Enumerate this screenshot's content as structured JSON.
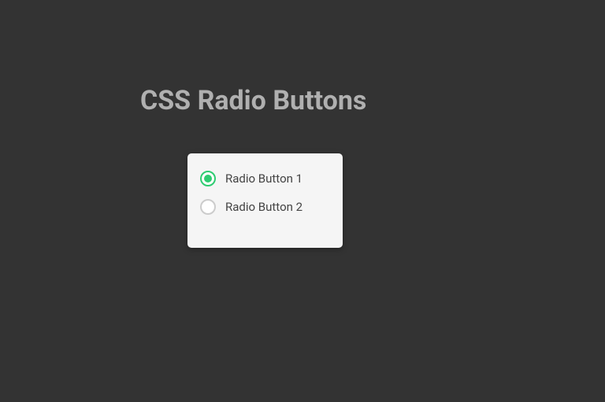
{
  "title": "CSS Radio Buttons",
  "options": [
    {
      "label": "Radio Button 1",
      "selected": true
    },
    {
      "label": "Radio Button 2",
      "selected": false
    }
  ],
  "colors": {
    "background": "#333333",
    "card": "#f5f5f5",
    "accent": "#2ecc71",
    "title": "#b0b0b0",
    "label": "#444444"
  }
}
